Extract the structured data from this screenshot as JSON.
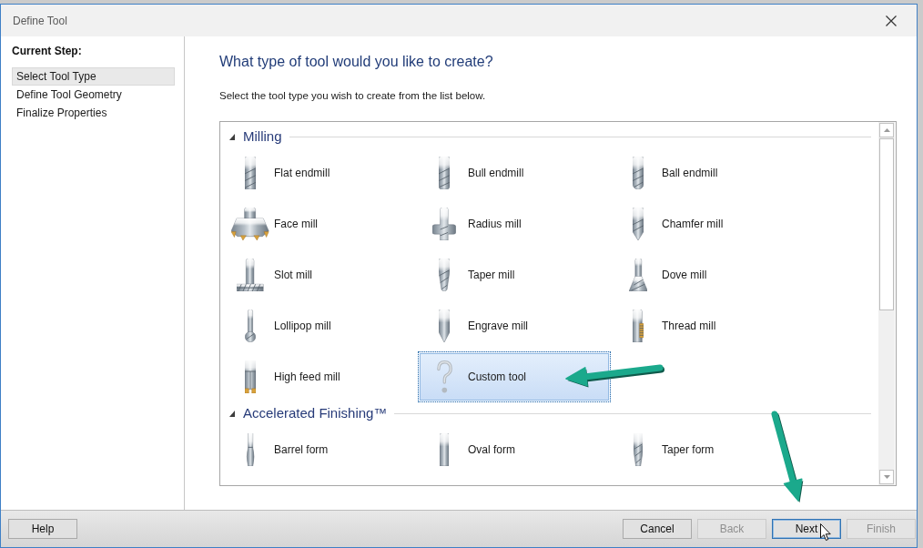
{
  "window": {
    "title": "Define Tool"
  },
  "sidebar": {
    "heading": "Current Step:",
    "steps": [
      {
        "label": "Select Tool Type",
        "selected": true
      },
      {
        "label": "Define Tool Geometry",
        "selected": false
      },
      {
        "label": "Finalize Properties",
        "selected": false
      }
    ]
  },
  "page": {
    "heading": "What type of tool would you like to create?",
    "instruction": "Select the tool type you wish to create from the list below."
  },
  "tool_list": {
    "groups": [
      {
        "name": "Milling",
        "expanded": true,
        "tools": [
          {
            "label": "Flat endmill",
            "kind": "flat",
            "selected": false
          },
          {
            "label": "Bull endmill",
            "kind": "bull",
            "selected": false
          },
          {
            "label": "Ball endmill",
            "kind": "ball",
            "selected": false
          },
          {
            "label": "Face mill",
            "kind": "face",
            "selected": false
          },
          {
            "label": "Radius mill",
            "kind": "radius",
            "selected": false
          },
          {
            "label": "Chamfer mill",
            "kind": "chamfer",
            "selected": false
          },
          {
            "label": "Slot mill",
            "kind": "slot",
            "selected": false
          },
          {
            "label": "Taper mill",
            "kind": "taper",
            "selected": false
          },
          {
            "label": "Dove mill",
            "kind": "dove",
            "selected": false
          },
          {
            "label": "Lollipop mill",
            "kind": "lollipop",
            "selected": false
          },
          {
            "label": "Engrave mill",
            "kind": "engrave",
            "selected": false
          },
          {
            "label": "Thread mill",
            "kind": "thread",
            "selected": false
          },
          {
            "label": "High feed mill",
            "kind": "highfeed",
            "selected": false
          },
          {
            "label": "Custom tool",
            "kind": "custom",
            "selected": true
          }
        ]
      },
      {
        "name": "Accelerated Finishing™",
        "expanded": true,
        "tools": [
          {
            "label": "Barrel form",
            "kind": "barrel",
            "selected": false
          },
          {
            "label": "Oval form",
            "kind": "oval",
            "selected": false
          },
          {
            "label": "Taper form",
            "kind": "taperform",
            "selected": false
          }
        ]
      }
    ]
  },
  "footer": {
    "left_buttons": [
      {
        "label": "Help",
        "disabled": false,
        "default": false
      }
    ],
    "right_buttons": [
      {
        "label": "Cancel",
        "disabled": false,
        "default": false
      },
      {
        "label": "Back",
        "disabled": true,
        "default": false
      },
      {
        "label": "Next",
        "disabled": false,
        "default": true
      },
      {
        "label": "Finish",
        "disabled": true,
        "default": false
      }
    ]
  }
}
